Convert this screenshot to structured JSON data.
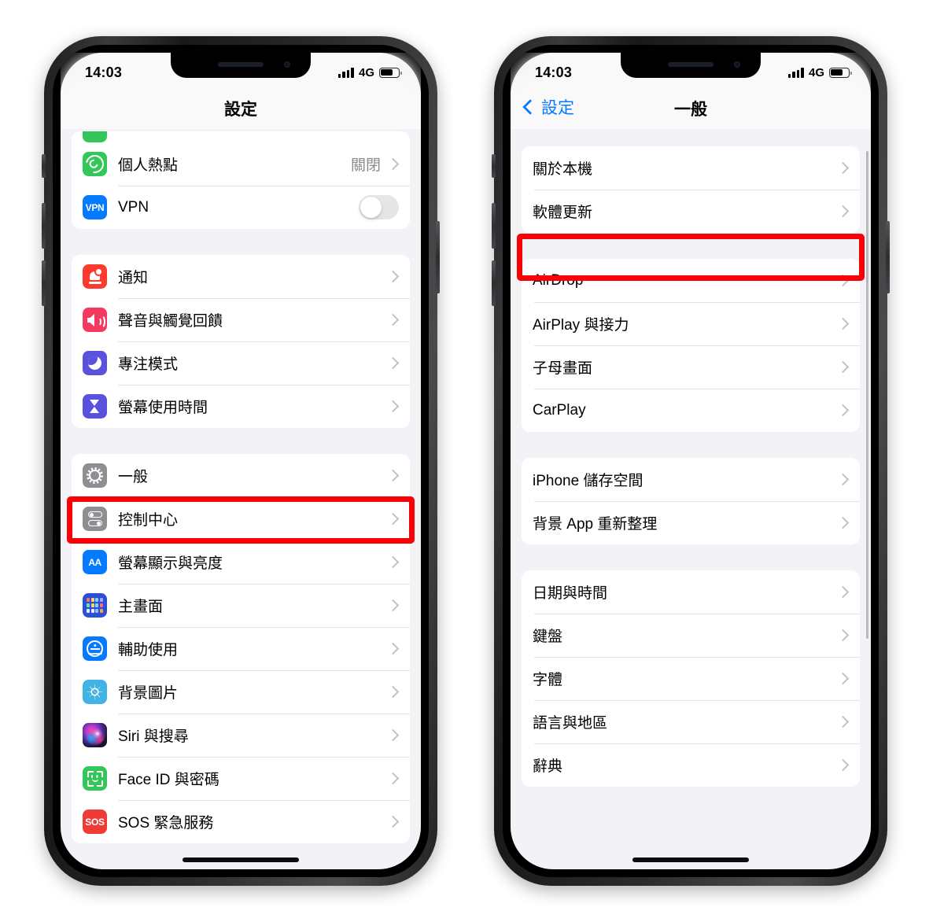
{
  "status_bar": {
    "time": "14:03",
    "network": "4G",
    "signal_icon": "cellular-bars-icon",
    "battery_icon": "battery-icon"
  },
  "left_phone": {
    "nav": {
      "title": "設定"
    },
    "groups": [
      {
        "id": "connectivity",
        "rows": [
          {
            "label": "個人熱點",
            "value": "關閉",
            "icon": "personal-hotspot-icon",
            "accessory": "chevron"
          },
          {
            "label": "VPN",
            "value": "",
            "icon": "vpn-icon",
            "accessory": "toggle",
            "toggle_on": false
          }
        ]
      },
      {
        "id": "alerts",
        "rows": [
          {
            "label": "通知",
            "value": "",
            "icon": "notifications-bell-icon",
            "accessory": "chevron"
          },
          {
            "label": "聲音與觸覺回饋",
            "value": "",
            "icon": "sounds-haptics-icon",
            "accessory": "chevron"
          },
          {
            "label": "專注模式",
            "value": "",
            "icon": "focus-moon-icon",
            "accessory": "chevron"
          },
          {
            "label": "螢幕使用時間",
            "value": "",
            "icon": "screen-time-hourglass-icon",
            "accessory": "chevron"
          }
        ]
      },
      {
        "id": "system",
        "rows": [
          {
            "label": "一般",
            "value": "",
            "icon": "general-gear-icon",
            "accessory": "chevron",
            "highlighted": true
          },
          {
            "label": "控制中心",
            "value": "",
            "icon": "control-center-icon",
            "accessory": "chevron"
          },
          {
            "label": "螢幕顯示與亮度",
            "value": "",
            "icon": "display-brightness-aa-icon",
            "accessory": "chevron"
          },
          {
            "label": "主畫面",
            "value": "",
            "icon": "home-screen-grid-icon",
            "accessory": "chevron"
          },
          {
            "label": "輔助使用",
            "value": "",
            "icon": "accessibility-icon",
            "accessory": "chevron"
          },
          {
            "label": "背景圖片",
            "value": "",
            "icon": "wallpaper-flower-icon",
            "accessory": "chevron"
          },
          {
            "label": "Siri 與搜尋",
            "value": "",
            "icon": "siri-orb-icon",
            "accessory": "chevron"
          },
          {
            "label": "Face ID 與密碼",
            "value": "",
            "icon": "face-id-icon",
            "accessory": "chevron"
          },
          {
            "label": "SOS 緊急服務",
            "value": "",
            "icon": "emergency-sos-icon",
            "accessory": "chevron"
          }
        ]
      }
    ]
  },
  "right_phone": {
    "nav": {
      "back_label": "設定",
      "title": "一般"
    },
    "groups": [
      {
        "id": "about",
        "rows": [
          {
            "label": "關於本機",
            "accessory": "chevron"
          },
          {
            "label": "軟體更新",
            "accessory": "chevron",
            "highlighted": true
          }
        ]
      },
      {
        "id": "sharing",
        "rows": [
          {
            "label": "AirDrop",
            "accessory": "chevron"
          },
          {
            "label": "AirPlay 與接力",
            "accessory": "chevron"
          },
          {
            "label": "子母畫面",
            "accessory": "chevron"
          },
          {
            "label": "CarPlay",
            "accessory": "chevron"
          }
        ]
      },
      {
        "id": "storage",
        "rows": [
          {
            "label": "iPhone 儲存空間",
            "accessory": "chevron"
          },
          {
            "label": "背景 App 重新整理",
            "accessory": "chevron"
          }
        ]
      },
      {
        "id": "locale",
        "rows": [
          {
            "label": "日期與時間",
            "accessory": "chevron"
          },
          {
            "label": "鍵盤",
            "accessory": "chevron"
          },
          {
            "label": "字體",
            "accessory": "chevron"
          },
          {
            "label": "語言與地區",
            "accessory": "chevron"
          },
          {
            "label": "辭典",
            "accessory": "chevron"
          }
        ]
      }
    ]
  },
  "annotations": {
    "highlight_color": "#fb0007",
    "left_highlight_target": "一般",
    "right_highlight_target": "軟體更新"
  },
  "colors": {
    "accent_blue": "#047aff",
    "screen_background": "#f2f2f7",
    "row_background": "#ffffff",
    "separator": "#e3e3e6",
    "secondary_text": "#8a8a8e"
  }
}
